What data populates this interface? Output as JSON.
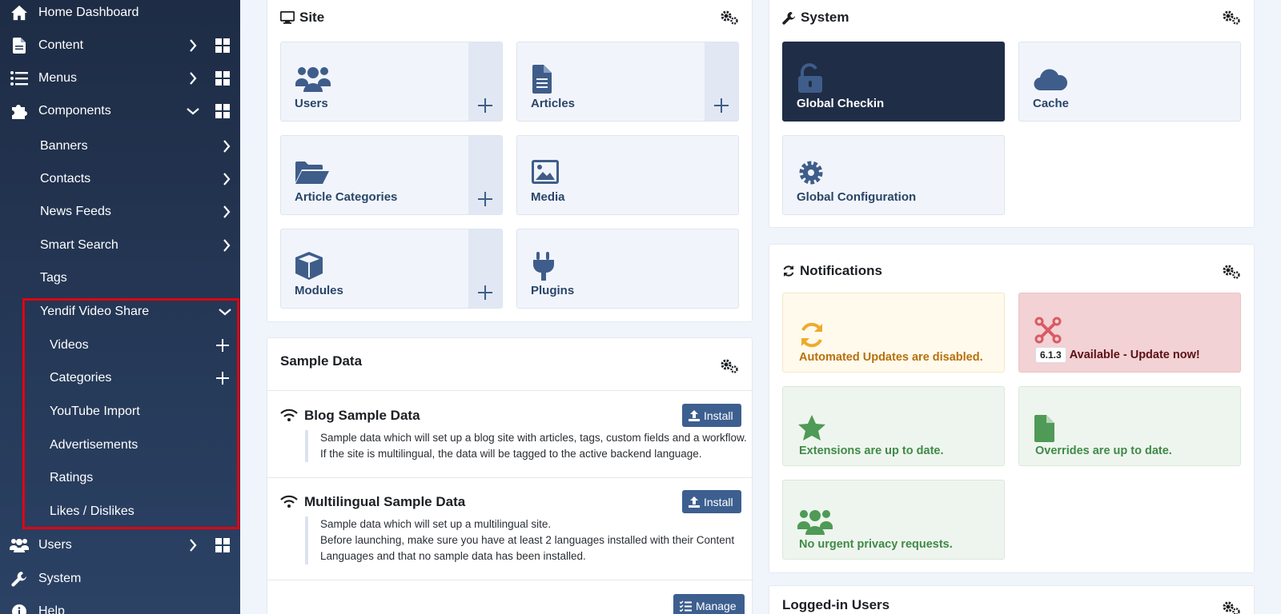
{
  "sidebar": {
    "home": "Home Dashboard",
    "content": "Content",
    "menus": "Menus",
    "components": "Components",
    "banners": "Banners",
    "contacts": "Contacts",
    "news_feeds": "News Feeds",
    "smart_search": "Smart Search",
    "tags": "Tags",
    "yendif": "Yendif Video Share",
    "videos": "Videos",
    "categories": "Categories",
    "youtube_import": "YouTube Import",
    "advertisements": "Advertisements",
    "ratings": "Ratings",
    "likes": "Likes / Dislikes",
    "users": "Users",
    "system": "System",
    "help": "Help"
  },
  "site": {
    "title": "Site",
    "tiles": {
      "users": "Users",
      "articles": "Articles",
      "article_categories": "Article Categories",
      "media": "Media",
      "modules": "Modules",
      "plugins": "Plugins"
    }
  },
  "system": {
    "title": "System",
    "tiles": {
      "global_checkin": "Global Checkin",
      "cache": "Cache",
      "global_configuration": "Global Configuration"
    }
  },
  "sample_data": {
    "title": "Sample Data",
    "blog": {
      "title": "Blog Sample Data",
      "desc1": "Sample data which will set up a blog site with articles, tags, custom fields and a workflow.",
      "desc2": "If the site is multilingual, the data will be tagged to the active backend language.",
      "button": "Install"
    },
    "multilingual": {
      "title": "Multilingual Sample Data",
      "desc1": "Sample data which will set up a multilingual site.",
      "desc2": "Before launching, make sure you have at least 2 languages installed with their Content",
      "desc3": "Languages and that no sample data has been installed.",
      "button": "Install"
    },
    "manage": "Manage"
  },
  "notifications": {
    "title": "Notifications",
    "automated_updates": "Automated Updates are disabled.",
    "version": "6.1.3",
    "update_available": "Available - Update now!",
    "extensions": "Extensions are up to date.",
    "overrides": "Overrides are up to date.",
    "privacy": "No urgent privacy requests."
  },
  "logged_in": {
    "title": "Logged-in Users"
  },
  "colors": {
    "sidebar_top": "#1e2c45",
    "sidebar_bottom": "#2b4265",
    "highlight": "#e3000f",
    "tile_icon": "#3f5d8a",
    "button": "#3d5f8f",
    "warning_bg": "#fffaec",
    "warning_text": "#b7700a",
    "danger_bg": "#f2d2d4",
    "success_bg": "#eef5ee",
    "success_text": "#3f8a47"
  }
}
